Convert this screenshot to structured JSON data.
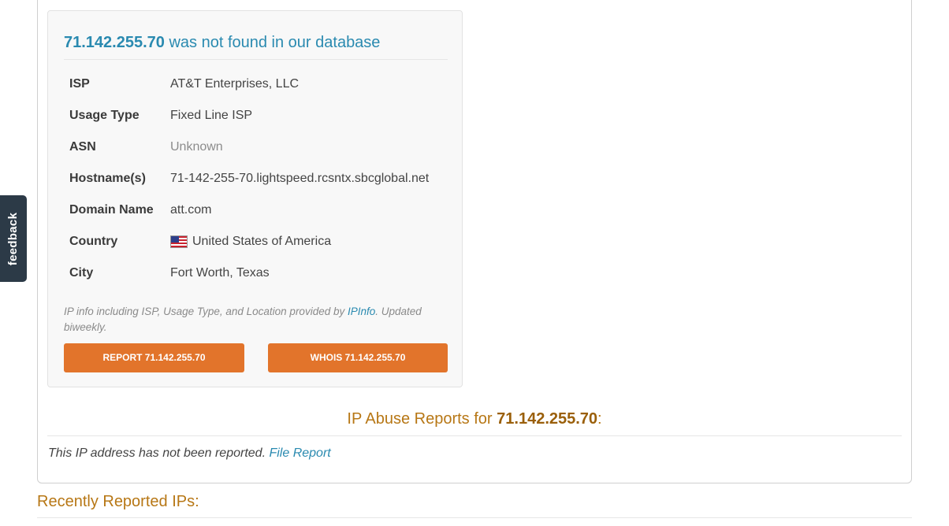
{
  "lookup": {
    "ip": "71.142.255.70",
    "not_found_text": " was not found in our database"
  },
  "info_rows": [
    {
      "label": "ISP",
      "value": "AT&T Enterprises, LLC"
    },
    {
      "label": "Usage Type",
      "value": "Fixed Line ISP"
    },
    {
      "label": "ASN",
      "value": "Unknown"
    },
    {
      "label": "Hostname(s)",
      "value": "71-142-255-70.lightspeed.rcsntx.sbcglobal.net"
    },
    {
      "label": "Domain Name",
      "value": "att.com"
    },
    {
      "label": "Country",
      "value": "United States of America",
      "icon": "us-flag-icon"
    },
    {
      "label": "City",
      "value": "Fort Worth, Texas"
    }
  ],
  "attribution": {
    "prefix": "IP info including ISP, Usage Type, and Location provided by ",
    "link": "IPInfo",
    "suffix": ". Updated biweekly."
  },
  "buttons": {
    "report": "REPORT 71.142.255.70",
    "whois": "WHOIS 71.142.255.70"
  },
  "abuse_reports": {
    "heading_prefix": "IP Abuse Reports for ",
    "ip": "71.142.255.70",
    "heading_suffix": ":",
    "note": "This IP address has not been reported. ",
    "file_report_link": "File Report"
  },
  "recent": {
    "heading": "Recently Reported IPs:"
  },
  "feedback_tab": "feedback",
  "colors": {
    "link_blue": "#2a8ab0",
    "button_orange": "#e2742b",
    "heading_gold": "#b77715",
    "feedback_bg": "#2c3a47"
  }
}
